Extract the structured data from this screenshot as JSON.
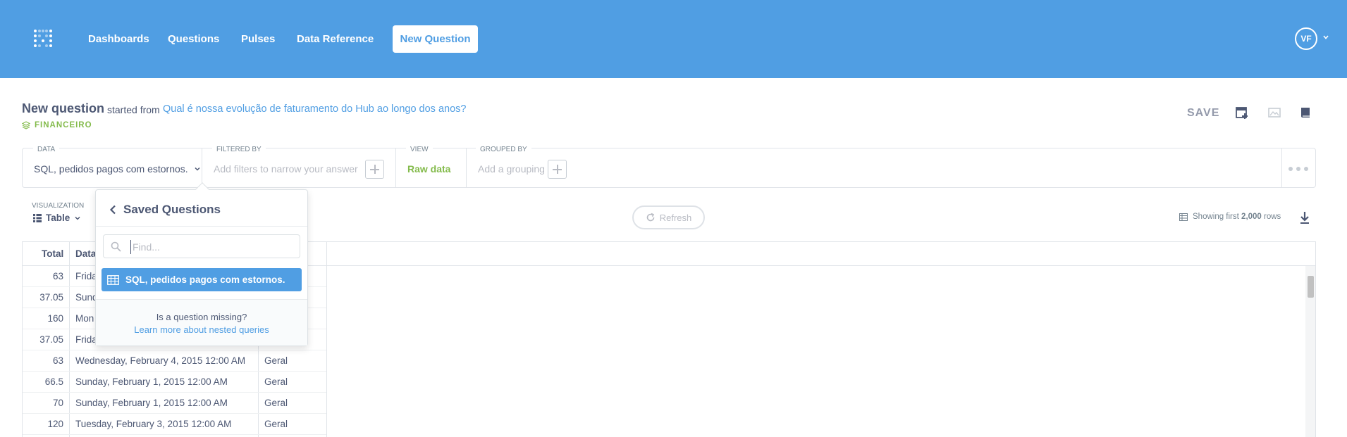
{
  "nav": {
    "links": [
      "Dashboards",
      "Questions",
      "Pulses",
      "Data Reference"
    ],
    "new_question": "New Question",
    "avatar_initials": "VF"
  },
  "header": {
    "title": "New question",
    "started_from": "started from",
    "source_question": "Qual é nossa evolução de faturamento do Hub ao longo dos anos?",
    "database": "FINANCEIRO",
    "save": "SAVE"
  },
  "query_builder": {
    "data_label": "DATA",
    "data_value": "SQL, pedidos pagos com estornos.",
    "filter_label": "FILTERED BY",
    "filter_placeholder": "Add filters to narrow your answer",
    "view_label": "VIEW",
    "view_value": "Raw data",
    "group_label": "GROUPED BY",
    "group_placeholder": "Add a grouping"
  },
  "visualization": {
    "label": "VISUALIZATION",
    "value": "Table",
    "refresh": "Refresh",
    "rows_prefix": "Showing first",
    "rows_count": "2,000",
    "rows_suffix": "rows"
  },
  "table": {
    "columns": [
      "Total",
      "Data"
    ],
    "rows": [
      {
        "total": "63",
        "date": "Frida",
        "cat": ""
      },
      {
        "total": "37.05",
        "date": "Sund",
        "cat": ""
      },
      {
        "total": "160",
        "date": "Mon",
        "cat": ""
      },
      {
        "total": "37.05",
        "date": "Frida",
        "cat": ""
      },
      {
        "total": "63",
        "date": "Wednesday, February 4, 2015 12:00 AM",
        "cat": "Geral"
      },
      {
        "total": "66.5",
        "date": "Sunday, February 1, 2015 12:00 AM",
        "cat": "Geral"
      },
      {
        "total": "70",
        "date": "Sunday, February 1, 2015 12:00 AM",
        "cat": "Geral"
      },
      {
        "total": "120",
        "date": "Tuesday, February 3, 2015 12:00 AM",
        "cat": "Geral"
      }
    ]
  },
  "popover": {
    "title": "Saved Questions",
    "search_placeholder": "Find...",
    "selected_item": "SQL, pedidos pagos com estornos.",
    "missing_text": "Is a question missing?",
    "learn_link": "Learn more about nested queries"
  },
  "colors": {
    "brand": "#509ee3",
    "accent_green": "#84bb4c",
    "text": "#4c5773"
  }
}
